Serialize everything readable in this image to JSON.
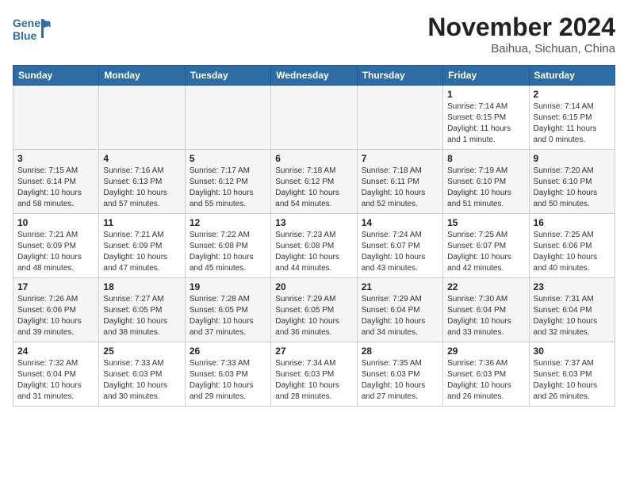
{
  "header": {
    "logo_line1": "General",
    "logo_line2": "Blue",
    "month_title": "November 2024",
    "location": "Baihua, Sichuan, China"
  },
  "weekdays": [
    "Sunday",
    "Monday",
    "Tuesday",
    "Wednesday",
    "Thursday",
    "Friday",
    "Saturday"
  ],
  "weeks": [
    [
      {
        "day": "",
        "info": ""
      },
      {
        "day": "",
        "info": ""
      },
      {
        "day": "",
        "info": ""
      },
      {
        "day": "",
        "info": ""
      },
      {
        "day": "",
        "info": ""
      },
      {
        "day": "1",
        "info": "Sunrise: 7:14 AM\nSunset: 6:15 PM\nDaylight: 11 hours\nand 1 minute."
      },
      {
        "day": "2",
        "info": "Sunrise: 7:14 AM\nSunset: 6:15 PM\nDaylight: 11 hours\nand 0 minutes."
      }
    ],
    [
      {
        "day": "3",
        "info": "Sunrise: 7:15 AM\nSunset: 6:14 PM\nDaylight: 10 hours\nand 58 minutes."
      },
      {
        "day": "4",
        "info": "Sunrise: 7:16 AM\nSunset: 6:13 PM\nDaylight: 10 hours\nand 57 minutes."
      },
      {
        "day": "5",
        "info": "Sunrise: 7:17 AM\nSunset: 6:12 PM\nDaylight: 10 hours\nand 55 minutes."
      },
      {
        "day": "6",
        "info": "Sunrise: 7:18 AM\nSunset: 6:12 PM\nDaylight: 10 hours\nand 54 minutes."
      },
      {
        "day": "7",
        "info": "Sunrise: 7:18 AM\nSunset: 6:11 PM\nDaylight: 10 hours\nand 52 minutes."
      },
      {
        "day": "8",
        "info": "Sunrise: 7:19 AM\nSunset: 6:10 PM\nDaylight: 10 hours\nand 51 minutes."
      },
      {
        "day": "9",
        "info": "Sunrise: 7:20 AM\nSunset: 6:10 PM\nDaylight: 10 hours\nand 50 minutes."
      }
    ],
    [
      {
        "day": "10",
        "info": "Sunrise: 7:21 AM\nSunset: 6:09 PM\nDaylight: 10 hours\nand 48 minutes."
      },
      {
        "day": "11",
        "info": "Sunrise: 7:21 AM\nSunset: 6:09 PM\nDaylight: 10 hours\nand 47 minutes."
      },
      {
        "day": "12",
        "info": "Sunrise: 7:22 AM\nSunset: 6:08 PM\nDaylight: 10 hours\nand 45 minutes."
      },
      {
        "day": "13",
        "info": "Sunrise: 7:23 AM\nSunset: 6:08 PM\nDaylight: 10 hours\nand 44 minutes."
      },
      {
        "day": "14",
        "info": "Sunrise: 7:24 AM\nSunset: 6:07 PM\nDaylight: 10 hours\nand 43 minutes."
      },
      {
        "day": "15",
        "info": "Sunrise: 7:25 AM\nSunset: 6:07 PM\nDaylight: 10 hours\nand 42 minutes."
      },
      {
        "day": "16",
        "info": "Sunrise: 7:25 AM\nSunset: 6:06 PM\nDaylight: 10 hours\nand 40 minutes."
      }
    ],
    [
      {
        "day": "17",
        "info": "Sunrise: 7:26 AM\nSunset: 6:06 PM\nDaylight: 10 hours\nand 39 minutes."
      },
      {
        "day": "18",
        "info": "Sunrise: 7:27 AM\nSunset: 6:05 PM\nDaylight: 10 hours\nand 38 minutes."
      },
      {
        "day": "19",
        "info": "Sunrise: 7:28 AM\nSunset: 6:05 PM\nDaylight: 10 hours\nand 37 minutes."
      },
      {
        "day": "20",
        "info": "Sunrise: 7:29 AM\nSunset: 6:05 PM\nDaylight: 10 hours\nand 36 minutes."
      },
      {
        "day": "21",
        "info": "Sunrise: 7:29 AM\nSunset: 6:04 PM\nDaylight: 10 hours\nand 34 minutes."
      },
      {
        "day": "22",
        "info": "Sunrise: 7:30 AM\nSunset: 6:04 PM\nDaylight: 10 hours\nand 33 minutes."
      },
      {
        "day": "23",
        "info": "Sunrise: 7:31 AM\nSunset: 6:04 PM\nDaylight: 10 hours\nand 32 minutes."
      }
    ],
    [
      {
        "day": "24",
        "info": "Sunrise: 7:32 AM\nSunset: 6:04 PM\nDaylight: 10 hours\nand 31 minutes."
      },
      {
        "day": "25",
        "info": "Sunrise: 7:33 AM\nSunset: 6:03 PM\nDaylight: 10 hours\nand 30 minutes."
      },
      {
        "day": "26",
        "info": "Sunrise: 7:33 AM\nSunset: 6:03 PM\nDaylight: 10 hours\nand 29 minutes."
      },
      {
        "day": "27",
        "info": "Sunrise: 7:34 AM\nSunset: 6:03 PM\nDaylight: 10 hours\nand 28 minutes."
      },
      {
        "day": "28",
        "info": "Sunrise: 7:35 AM\nSunset: 6:03 PM\nDaylight: 10 hours\nand 27 minutes."
      },
      {
        "day": "29",
        "info": "Sunrise: 7:36 AM\nSunset: 6:03 PM\nDaylight: 10 hours\nand 26 minutes."
      },
      {
        "day": "30",
        "info": "Sunrise: 7:37 AM\nSunset: 6:03 PM\nDaylight: 10 hours\nand 26 minutes."
      }
    ]
  ]
}
